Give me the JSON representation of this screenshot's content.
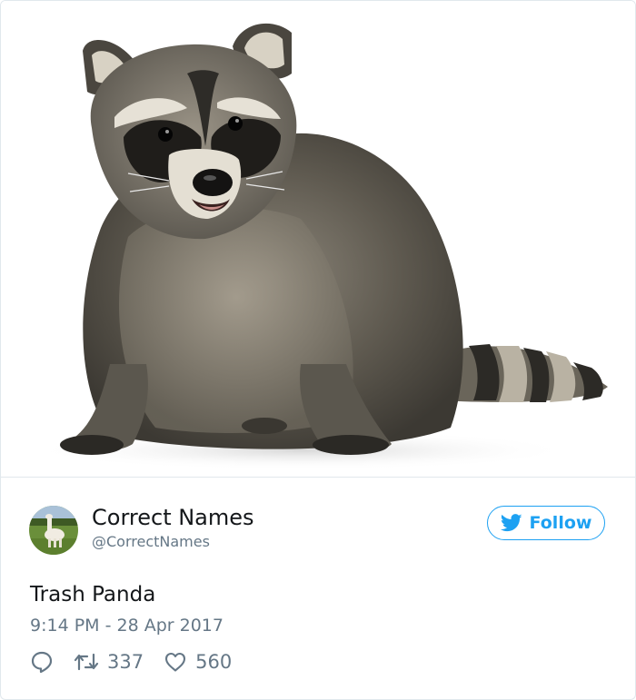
{
  "tweet": {
    "image_alt": "raccoon photo",
    "author": {
      "display_name": "Correct Names",
      "handle": "@CorrectNames",
      "avatar": "llama-avatar"
    },
    "follow_label": "Follow",
    "text": "Trash Panda",
    "timestamp": "9:14 PM - 28 Apr 2017",
    "retweets": "337",
    "likes": "560",
    "icons": {
      "reply": "speech-bubble-icon",
      "retweet": "retweet-icon",
      "like": "heart-icon",
      "follow": "twitter-bird-icon"
    },
    "colors": {
      "accent": "#1da1f2",
      "secondary_text": "#657786",
      "primary_text": "#14171a",
      "border": "#e1e8ed"
    }
  }
}
